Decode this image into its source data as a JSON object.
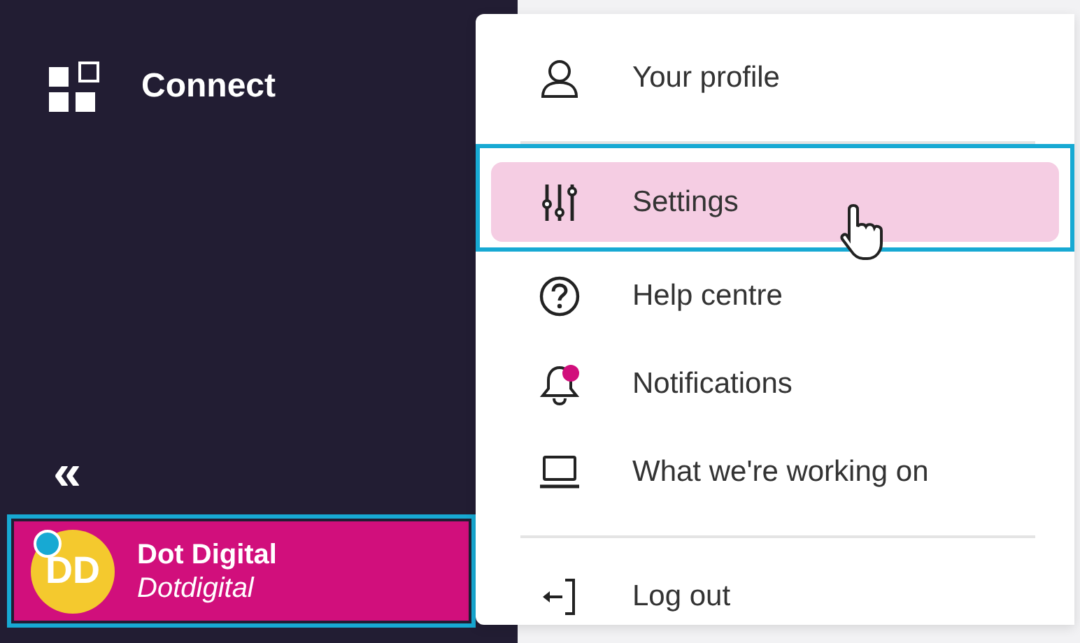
{
  "sidebar": {
    "app_name": "Connect",
    "collapse": "«",
    "profile": {
      "initials": "DD",
      "name": "Dot Digital",
      "organisation": "Dotdigital",
      "color": "#17a9d3",
      "highlighted": true
    }
  },
  "menu": {
    "sections": [
      [
        {
          "label": "Your profile",
          "selected": false,
          "highlighted": false,
          "unread": false
        }
      ],
      [
        {
          "label": "Settings",
          "selected": true,
          "highlighted": true,
          "unread": false
        },
        {
          "label": "Help centre",
          "selected": false,
          "highlighted": false,
          "unread": false
        },
        {
          "label": "Notifications",
          "selected": false,
          "highlighted": false,
          "unread": true
        },
        {
          "label": "What we're working on",
          "selected": false,
          "highlighted": false,
          "unread": false
        }
      ],
      [
        {
          "label": "Log out",
          "selected": false,
          "highlighted": false,
          "unread": false
        }
      ]
    ]
  }
}
